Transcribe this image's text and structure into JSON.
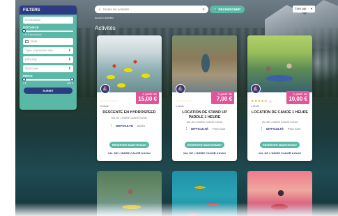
{
  "filters": {
    "title": "FILTERS",
    "destination_placeholder": "Destination",
    "distance_label": "DISTANCE",
    "distance_note": "1 to 5 km around",
    "date_placeholder": "Date",
    "practice_placeholder": "Type of practice site",
    "difficulty_placeholder": "Difficulty",
    "boat_placeholder": "Boat type",
    "price_label": "PRICE",
    "price_min": "0 €",
    "price_max": "600 €",
    "submit_label": "SUBMIT"
  },
  "search": {
    "placeholder": "Toutes les activités",
    "clear": "✕",
    "button_label": "🔍 RECHERCHER"
  },
  "sort": {
    "label": "Trier par",
    "chevron": "▼"
  },
  "breadcrumb": "Accueil / Activités",
  "heading": "Activités",
  "cards": [
    {
      "image": "rafting-photo",
      "price_from": "À partir de",
      "price": "15,00 €",
      "rating": "☆☆☆☆☆",
      "rating_count": "",
      "duration": "0 heure",
      "title": "DESCENTE EN HYDROSPEED",
      "place": "VAL DE L'INDRE CANOË KAYAK",
      "difficulty_label": "DIFFICULTÉ",
      "difficulty_value": "Initiés",
      "reserve_label": "RÉSERVER MAINTENANT",
      "provider": "VAL DE L'INDRE CANOË KAYAK"
    },
    {
      "image": "paddle-photo",
      "price_from": "À partir de",
      "price": "7,00 €",
      "rating": "☆☆☆☆☆",
      "rating_count": "",
      "duration": "1 heure",
      "title": "LOCATION DE STAND UP PADDLE 1 HEURE",
      "place": "VAL DE L'INDRE CANOË KAYAK",
      "difficulty_label": "DIFFICULTÉ",
      "difficulty_value": "Pour tous",
      "reserve_label": "RÉSERVER MAINTENANT",
      "provider": "VAL DE L'INDRE CANOË KAYAK"
    },
    {
      "image": "canoe-photo",
      "price_from": "À partir de",
      "price": "10,00 €",
      "rating": "★★★★★",
      "rating_count": "(1)",
      "duration": "1 heure",
      "title": "LOCATION DE CANOË 1 HEURE",
      "place": "VAL DE L'INDRE CANOË KAYAK",
      "difficulty_label": "DIFFICULTÉ",
      "difficulty_value": "Pour tous",
      "reserve_label": "RÉSERVER MAINTENANT",
      "provider": "VAL DE L'INDRE CANOË KAYAK"
    }
  ],
  "icons": {
    "activity_badge": "kayak-icon",
    "difficulty": "bar-chart-icon"
  },
  "colors": {
    "navy": "#2d3b82",
    "teal": "#5ab8a6",
    "pink": "#e0559a"
  }
}
